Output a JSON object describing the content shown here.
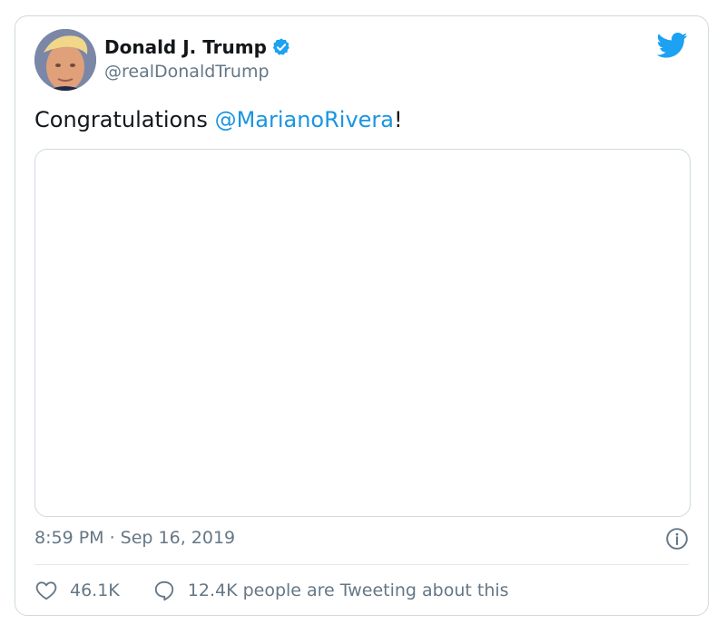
{
  "tweet": {
    "author_name": "Donald J. Trump",
    "handle": "@realDonaldTrump",
    "text_before": "Congratulations ",
    "mention": "@MarianoRivera",
    "text_after": "!",
    "timestamp": "8:59 PM · Sep 16, 2019",
    "likes": "46.1K",
    "people_tweeting": "12.4K people are Tweeting about this"
  },
  "icons": {
    "verified": "verified-badge-icon",
    "brand": "twitter-bird-icon",
    "info": "info-icon",
    "like": "heart-icon",
    "reply": "speech-bubble-icon"
  },
  "colors": {
    "accent": "#1da1f2",
    "mention": "#1b95e0",
    "secondary_text": "#657786",
    "border": "#cfd9de"
  }
}
